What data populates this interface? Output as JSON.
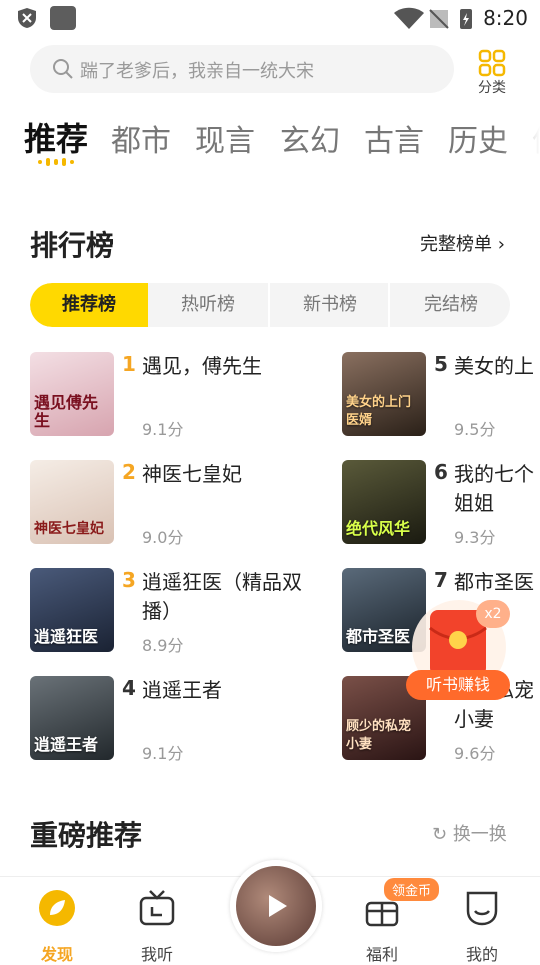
{
  "status_bar": {
    "time": "8:20"
  },
  "search": {
    "placeholder": "踹了老爹后，我亲自一统大宋"
  },
  "category": {
    "label": "分类"
  },
  "tabs": [
    "推荐",
    "都市",
    "现言",
    "玄幻",
    "古言",
    "历史",
    "体"
  ],
  "ranking": {
    "title": "排行榜",
    "more_label": "完整榜单",
    "segments": [
      "推荐榜",
      "热听榜",
      "新书榜",
      "完结榜"
    ],
    "books": [
      {
        "rank": "1",
        "title": "遇见，傅先生",
        "score": "9.1分",
        "cover_text": "遇见傅先生",
        "cover_color": "#e8c9cf"
      },
      {
        "rank": "2",
        "title": "神医七皇妃",
        "score": "9.0分",
        "cover_text": "神医七皇妃",
        "cover_color": "#e7d9cf"
      },
      {
        "rank": "3",
        "title": "逍遥狂医（精品双播）",
        "score": "8.9分",
        "cover_text": "逍遥狂医",
        "cover_color": "#2a3550"
      },
      {
        "rank": "4",
        "title": "逍遥王者",
        "score": "9.1分",
        "cover_text": "逍遥王者",
        "cover_color": "#3a4248"
      },
      {
        "rank": "5",
        "title": "美女的上",
        "score": "9.5分",
        "cover_text": "美女的上门医婿",
        "cover_color": "#5a4a3a"
      },
      {
        "rank": "6",
        "title": "我的七个姐姐",
        "score": "9.3分",
        "cover_text": "绝代风华",
        "cover_color": "#3a3a2a"
      },
      {
        "rank": "7",
        "title": "都市圣医",
        "score": "",
        "cover_text": "都市圣医",
        "cover_color": "#3a4a5a"
      },
      {
        "rank": "",
        "title": "独爱私宠小妻",
        "score": "9.6分",
        "cover_text": "顾少的私宠小妻",
        "cover_color": "#4a3030"
      }
    ]
  },
  "featured": {
    "title": "重磅推荐",
    "refresh_label": "换一换"
  },
  "float_reward": {
    "multiplier": "x2",
    "label": "听书赚钱"
  },
  "bottom_nav": {
    "items": [
      "发现",
      "我听",
      "福利",
      "我的"
    ],
    "badge": "领金币"
  },
  "colors": {
    "accent": "#ffd900",
    "rank_top": "#f5a623",
    "rank_other": "#333333",
    "reward": "#ff6a2b"
  }
}
